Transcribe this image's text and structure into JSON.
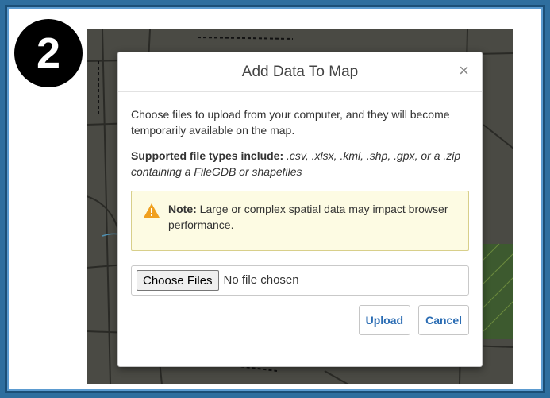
{
  "step": {
    "number": "2"
  },
  "dialog": {
    "title": "Add Data To Map",
    "close_symbol": "×",
    "intro": "Choose files to upload from your computer, and they will become temporarily available on the map.",
    "supported_label": "Supported file types include:",
    "supported_types": ".csv, .xlsx, .kml, .shp, .gpx, or a .zip containing a FileGDB or shapefiles",
    "note_label": "Note:",
    "note_text": "Large or complex spatial data may impact browser performance.",
    "file_input": {
      "button_label": "Choose Files",
      "status": "No file chosen"
    },
    "upload_label": "Upload",
    "cancel_label": "Cancel"
  },
  "colors": {
    "frame_blue": "#2e6e9e",
    "accent": "#2a6cb3",
    "warning": "#f0a020",
    "note_bg": "#fdfbe3"
  },
  "icons": {
    "close": "close-icon",
    "warning": "warning-icon"
  }
}
